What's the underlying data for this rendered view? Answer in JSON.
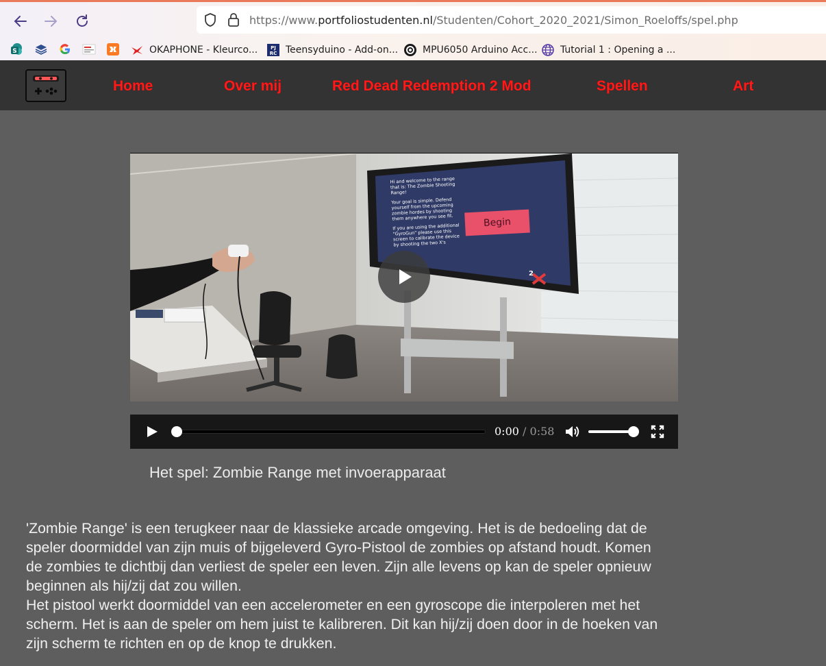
{
  "browser": {
    "url_prefix": "https://www.",
    "url_domain": "portfoliostudenten.nl",
    "url_path": "/Studenten/Cohort_2020_2021/Simon_Roeloffs/spel.php",
    "bookmarks": [
      {
        "icon": "sharepoint-icon",
        "label": ""
      },
      {
        "icon": "layers-icon",
        "label": ""
      },
      {
        "icon": "google-icon",
        "label": ""
      },
      {
        "icon": "site-icon",
        "label": ""
      },
      {
        "icon": "xampp-icon",
        "label": ""
      },
      {
        "icon": "okaphone-icon",
        "label": "OKAPHONE - Kleurco..."
      },
      {
        "icon": "pjrc-icon",
        "label": "Teensyduino - Add-on..."
      },
      {
        "icon": "mpu-icon",
        "label": "MPU6050 Arduino Acc..."
      },
      {
        "icon": "globe-icon",
        "label": "Tutorial 1 : Opening a ..."
      }
    ]
  },
  "site_nav": {
    "items": [
      "Home",
      "Over mij",
      "Red Dead Redemption 2 Mod",
      "Spellen",
      "Art"
    ]
  },
  "video": {
    "screen_text_1": "Hi and welcome to the range that is: The Zombie Shooting Range!",
    "screen_text_2": "Your goal is simple. Defend yourself from the upcoming zombie hordes by shooting them anywhere you see fit.",
    "screen_text_3": "If you are using the additional \"GyroGun\" please use this screen to calibrate the device by shooting the two X's",
    "screen_button": "Begin",
    "current_time": "0:00",
    "separator": "/",
    "duration": "0:58",
    "progress": 0,
    "volume": 1.0
  },
  "caption": "Het spel: Zombie Range met invoerapparaat",
  "description": {
    "paragraph_1": "'Zombie Range' is een terugkeer naar de klassieke arcade omgeving. Het is de bedoeling dat de speler doormiddel van zijn muis of bijgeleverd Gyro-Pistool de zombies op afstand houdt. Komen de zombies te dichtbij dan verliest de speler een leven. Zijn alle levens op kan de speler opnieuw beginnen als hij/zij dat zou willen.",
    "paragraph_2": "Het pistool werkt doormiddel van een accelerometer en een gyroscope die interpoleren met het scherm. Het is aan de speler om hem juist te kalibreren. Dit kan hij/zij doen door in de hoeken van zijn scherm te richten en op de knop te drukken."
  },
  "colors": {
    "nav_link": "#ff1a1a",
    "nav_bg": "#333333",
    "page_bg": "#5e5e5e",
    "screen_button": "#e9506a"
  }
}
